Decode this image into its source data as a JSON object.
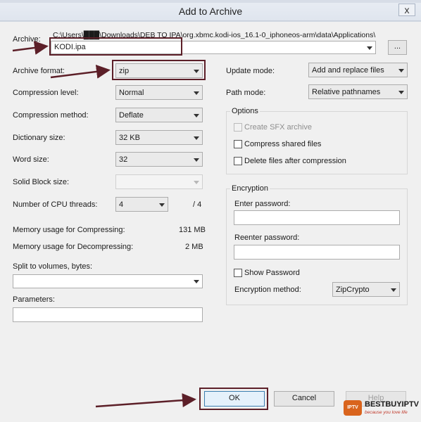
{
  "window": {
    "title": "Add to Archive",
    "close_glyph": "x"
  },
  "archive": {
    "label": "Archive:",
    "path": "C:\\Users\\███\\Downloads\\DEB TO IPA\\org.xbmc.kodi-ios_16.1-0_iphoneos-arm\\data\\Applications\\",
    "value": "KODI.ipa",
    "browse_label": "..."
  },
  "left": {
    "archive_format": {
      "label": "Archive format:",
      "value": "zip"
    },
    "compression_level": {
      "label": "Compression level:",
      "value": "Normal"
    },
    "compression_method": {
      "label": "Compression method:",
      "value": "Deflate"
    },
    "dictionary_size": {
      "label": "Dictionary size:",
      "value": "32 KB"
    },
    "word_size": {
      "label": "Word size:",
      "value": "32"
    },
    "solid_block_size": {
      "label": "Solid Block size:",
      "value": ""
    },
    "cpu_threads": {
      "label": "Number of CPU threads:",
      "value": "4",
      "max": "/ 4"
    },
    "memory_compressing": {
      "label": "Memory usage for Compressing:",
      "value": "131 MB"
    },
    "memory_decompressing": {
      "label": "Memory usage for Decompressing:",
      "value": "2 MB"
    },
    "split_volumes": {
      "label": "Split to volumes, bytes:",
      "value": ""
    },
    "parameters": {
      "label": "Parameters:",
      "value": ""
    }
  },
  "right": {
    "update_mode": {
      "label": "Update mode:",
      "value": "Add and replace files"
    },
    "path_mode": {
      "label": "Path mode:",
      "value": "Relative pathnames"
    },
    "options": {
      "title": "Options",
      "create_sfx": "Create SFX archive",
      "compress_shared": "Compress shared files",
      "delete_after": "Delete files after compression"
    },
    "encryption": {
      "title": "Encryption",
      "enter_password": "Enter password:",
      "reenter_password": "Reenter password:",
      "show_password": "Show Password",
      "method_label": "Encryption method:",
      "method_value": "ZipCrypto"
    }
  },
  "buttons": {
    "ok": "OK",
    "cancel": "Cancel",
    "help": "Help"
  },
  "watermark": {
    "badge": "IPTV",
    "brand": "BESTBUYIPTV",
    "tagline": "because you love life"
  },
  "colors": {
    "highlight": "#5c1f28",
    "arrow": "#5c1f28",
    "window_bg": "#f0f0f0"
  }
}
